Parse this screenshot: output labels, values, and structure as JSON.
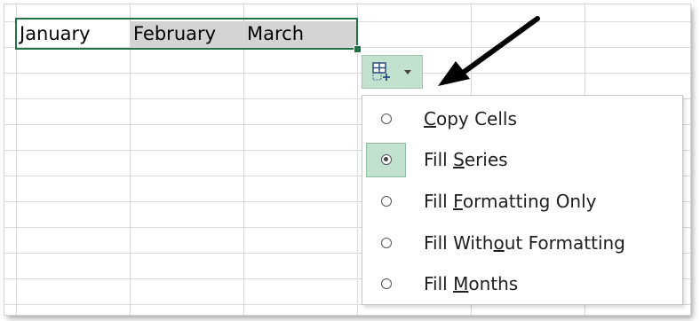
{
  "cells": {
    "a1": "January",
    "b1": "February",
    "c1": "March"
  },
  "autofill_button": {
    "icon": "autofill-options-icon",
    "dropdown_icon": "caret-down-icon",
    "accent_color": "#c3e1cf"
  },
  "selection_color": "#217346",
  "menu": {
    "items": [
      {
        "before": "",
        "mnemonic": "C",
        "after": "opy Cells",
        "selected": false
      },
      {
        "before": "Fill ",
        "mnemonic": "S",
        "after": "eries",
        "selected": true
      },
      {
        "before": "Fill ",
        "mnemonic": "F",
        "after": "ormatting Only",
        "selected": false
      },
      {
        "before": "Fill With",
        "mnemonic": "o",
        "after": "ut Formatting",
        "selected": false
      },
      {
        "before": "Fill ",
        "mnemonic": "M",
        "after": "onths",
        "selected": false
      }
    ]
  }
}
